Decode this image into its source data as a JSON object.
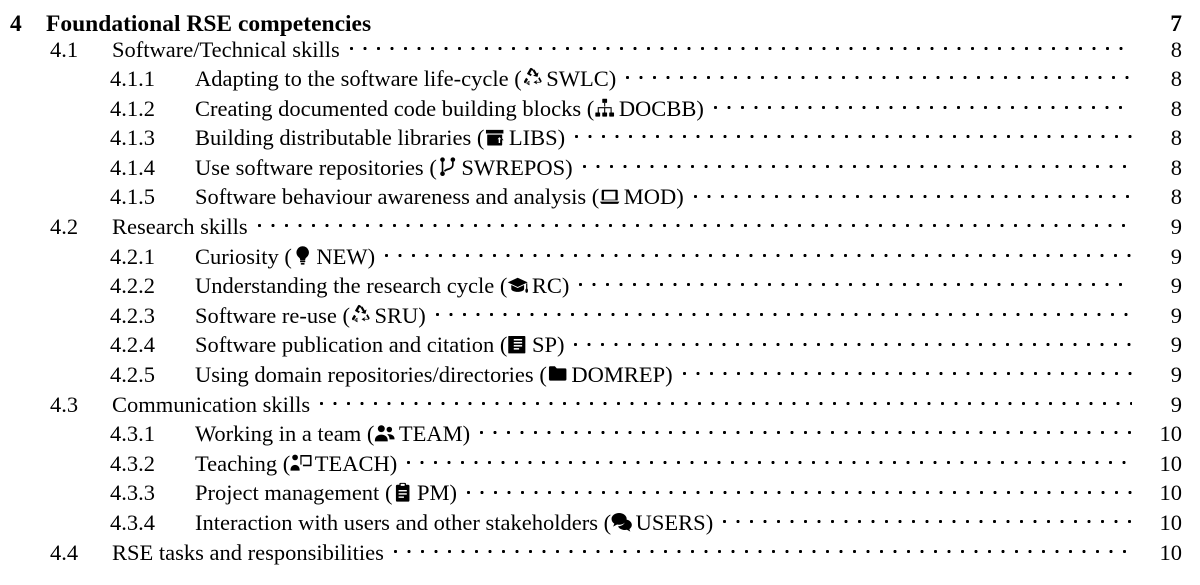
{
  "document": {
    "type": "table-of-contents",
    "text_color": "#000000",
    "background_color": "#ffffff"
  },
  "entries": [
    {
      "level": 1,
      "number": "4",
      "title": "Foundational RSE competencies",
      "page": "7",
      "icon": null,
      "code": null,
      "leader": false
    },
    {
      "level": 2,
      "number": "4.1",
      "title": "Software/Technical skills",
      "page": "8",
      "icon": null,
      "code": null,
      "leader": true
    },
    {
      "level": 3,
      "number": "4.1.1",
      "title": "Adapting to the software life-cycle",
      "page": "8",
      "icon": "recycle-icon",
      "code": "SWLC",
      "leader": true
    },
    {
      "level": 3,
      "number": "4.1.2",
      "title": "Creating documented code building blocks",
      "page": "8",
      "icon": "sitemap-icon",
      "code": "DOCBB",
      "leader": true
    },
    {
      "level": 3,
      "number": "4.1.3",
      "title": "Building distributable libraries",
      "page": "8",
      "icon": "box-arrow-up-icon",
      "code": "LIBS",
      "leader": true
    },
    {
      "level": 3,
      "number": "4.1.4",
      "title": "Use software repositories",
      "page": "8",
      "icon": "code-branch-icon",
      "code": "SWREPOS",
      "leader": true
    },
    {
      "level": 3,
      "number": "4.1.5",
      "title": "Software behaviour awareness and analysis",
      "page": "8",
      "icon": "laptop-code-icon",
      "code": "MOD",
      "leader": true
    },
    {
      "level": 2,
      "number": "4.2",
      "title": "Research skills",
      "page": "9",
      "icon": null,
      "code": null,
      "leader": true
    },
    {
      "level": 3,
      "number": "4.2.1",
      "title": "Curiosity",
      "page": "9",
      "icon": "lightbulb-icon",
      "code": "NEW",
      "leader": true
    },
    {
      "level": 3,
      "number": "4.2.2",
      "title": "Understanding the research cycle",
      "page": "9",
      "icon": "graduation-cap-icon",
      "code": "RC",
      "leader": true
    },
    {
      "level": 3,
      "number": "4.2.3",
      "title": "Software re-use",
      "page": "9",
      "icon": "recycle-icon",
      "code": "SRU",
      "leader": true
    },
    {
      "level": 3,
      "number": "4.2.4",
      "title": "Software publication and citation",
      "page": "9",
      "icon": "book-journal-icon",
      "code": "SP",
      "leader": true
    },
    {
      "level": 3,
      "number": "4.2.5",
      "title": "Using domain repositories/directories",
      "page": "9",
      "icon": "folder-icon",
      "code": "DOMREP",
      "leader": true
    },
    {
      "level": 2,
      "number": "4.3",
      "title": "Communication skills",
      "page": "9",
      "icon": null,
      "code": null,
      "leader": true
    },
    {
      "level": 3,
      "number": "4.3.1",
      "title": "Working in a team",
      "page": "10",
      "icon": "users-icon",
      "code": "TEAM",
      "leader": true
    },
    {
      "level": 3,
      "number": "4.3.2",
      "title": "Teaching",
      "page": "10",
      "icon": "chalkboard-teacher-icon",
      "code": "TEACH",
      "leader": true
    },
    {
      "level": 3,
      "number": "4.3.3",
      "title": "Project management",
      "page": "10",
      "icon": "clipboard-icon",
      "code": "PM",
      "leader": true
    },
    {
      "level": 3,
      "number": "4.3.4",
      "title": "Interaction with users and other stakeholders",
      "page": "10",
      "icon": "comments-icon",
      "code": "USERS",
      "leader": true
    },
    {
      "level": 2,
      "number": "4.4",
      "title": "RSE tasks and responsibilities",
      "page": "10",
      "icon": null,
      "code": null,
      "leader": true
    }
  ]
}
